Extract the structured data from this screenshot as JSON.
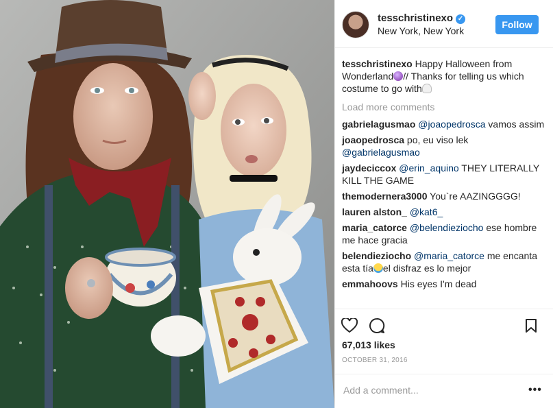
{
  "post": {
    "username": "tesschristinexo",
    "location": "New York, New York",
    "follow_label": "Follow",
    "caption_user": "tesschristinexo",
    "caption_text_1": "Happy Halloween from Wonderland",
    "caption_text_2": "// Thanks for telling us which costume to go with",
    "load_more": "Load more comments",
    "likes": "67,013 likes",
    "date": "OCTOBER 31, 2016",
    "add_comment_placeholder": "Add a comment...",
    "more_glyph": "•••"
  },
  "comments": [
    {
      "user": "gabrielagusmao",
      "mention": "@joaopedrosca",
      "text": " vamos assim"
    },
    {
      "user": "joaopedrosca",
      "text": " po, eu viso lek ",
      "mention2": "@gabrielagusmao"
    },
    {
      "user": "jaydeciccox",
      "mention": "@erin_aquino",
      "text": " THEY LITERALLY KILL THE GAME"
    },
    {
      "user": "themodernera3000",
      "text": " You`re AAZINGGGG!"
    },
    {
      "user": "lauren alston_",
      "mention": "@kat6_"
    },
    {
      "user": "maria_catorce",
      "mention": "@belendieziocho",
      "text": " ese hombre me hace gracia"
    },
    {
      "user": "belendieziocho",
      "mention": "@maria_catorce",
      "text": " me encanta esta tía",
      "text2": "el disfraz es lo mejor"
    },
    {
      "user": "emmahoovs",
      "text": " His eyes I'm dead"
    }
  ],
  "icons": {
    "verified": "verified-badge-icon",
    "like": "heart-icon",
    "comment": "speech-bubble-icon",
    "save": "bookmark-icon",
    "crystal_ball_emoji": "crystal-ball-emoji",
    "ghost_emoji": "ghost-emoji",
    "scream_emoji": "scream-emoji"
  },
  "colors": {
    "accent": "#3897f0",
    "mention": "#003569",
    "muted": "#999999"
  }
}
